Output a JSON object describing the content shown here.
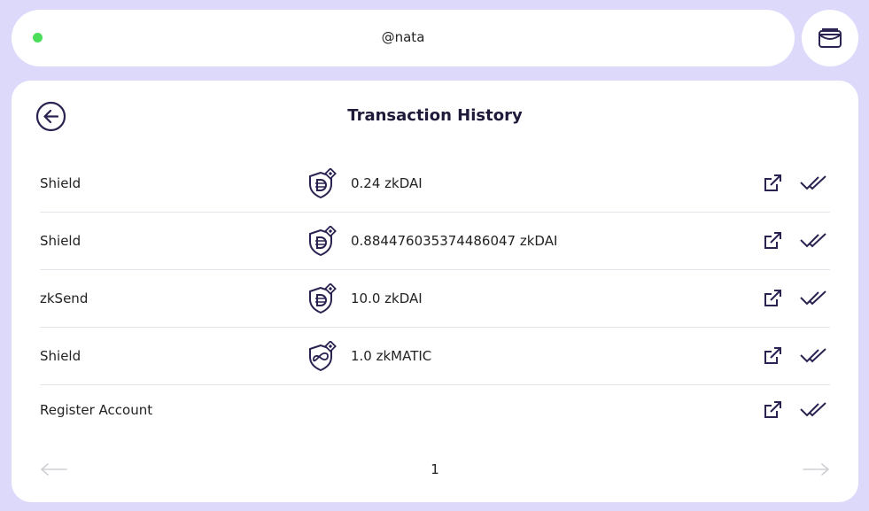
{
  "header": {
    "username": "@nata",
    "status_color": "#4ade5b",
    "wallet_icon": "wallet-icon"
  },
  "page": {
    "title": "Transaction History",
    "back_icon": "back-arrow-icon"
  },
  "transactions": [
    {
      "type": "Shield",
      "amount": "0.24 zkDAI",
      "token_icon": "shield-dai-icon"
    },
    {
      "type": "Shield",
      "amount": "0.884476035374486047 zkDAI",
      "token_icon": "shield-dai-icon"
    },
    {
      "type": "zkSend",
      "amount": "10.0 zkDAI",
      "token_icon": "shield-dai-icon"
    },
    {
      "type": "Shield",
      "amount": "1.0 zkMATIC",
      "token_icon": "shield-matic-icon"
    },
    {
      "type": "Register Account",
      "amount": "",
      "token_icon": ""
    }
  ],
  "pagination": {
    "current_page": "1"
  },
  "colors": {
    "background": "#dcd9fb",
    "accent": "#2a2250",
    "status_online": "#4ade5b"
  }
}
